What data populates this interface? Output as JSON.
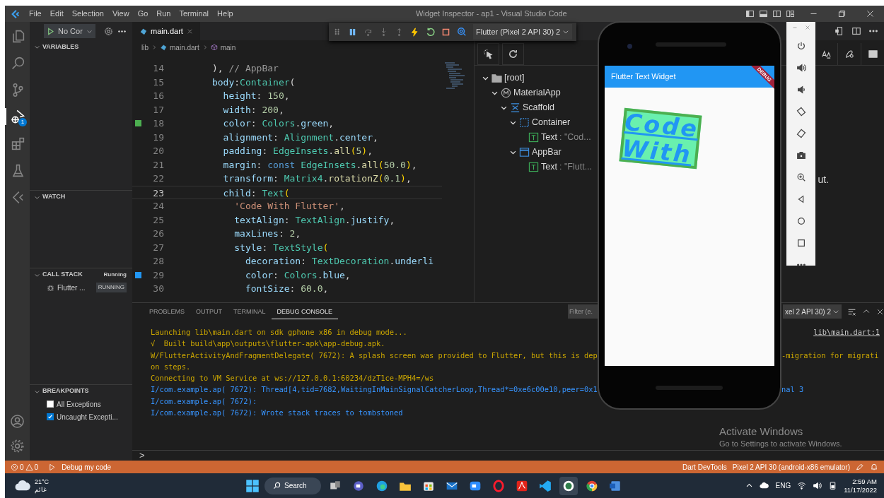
{
  "window": {
    "title": "Widget Inspector - ap1 - Visual Studio Code"
  },
  "menu": [
    "File",
    "Edit",
    "Selection",
    "View",
    "Go",
    "Run",
    "Terminal",
    "Help"
  ],
  "activity_bar": {
    "items": [
      {
        "selected": false
      },
      {
        "selected": false
      },
      {
        "selected": false
      },
      {
        "selected": true,
        "badge": "1"
      },
      {
        "selected": false
      },
      {
        "selected": false
      },
      {
        "selected": false
      }
    ]
  },
  "run_toolbar": {
    "config": "No Cor"
  },
  "sidebar": {
    "sections": [
      {
        "title": "VARIABLES",
        "expanded": true
      },
      {
        "title": "WATCH",
        "expanded": true
      },
      {
        "title": "CALL STACK",
        "expanded": true,
        "status": "Running",
        "items": [
          {
            "label": "Flutter ...",
            "badge": "RUNNING"
          }
        ]
      },
      {
        "title": "BREAKPOINTS",
        "expanded": true,
        "items": [
          {
            "label": "All Exceptions",
            "checked": false
          },
          {
            "label": "Uncaught Excepti...",
            "checked": true
          }
        ]
      }
    ]
  },
  "debug_toolbar": {
    "target": "Flutter (Pixel 2 API 30) 2"
  },
  "editor": {
    "tabs": [
      {
        "label": "main.dart",
        "selected": true
      }
    ],
    "breadcrumb": [
      "lib",
      "main.dart",
      "main"
    ],
    "lines": [
      {
        "number": "14",
        "current": false,
        "tokens": [
          {
            "kind": "punct",
            "text": "      ), "
          },
          {
            "kind": "comment",
            "text": "// AppBar"
          }
        ]
      },
      {
        "number": "15",
        "current": false,
        "tokens": [
          {
            "kind": "prop",
            "text": "      body"
          },
          {
            "kind": "punct",
            "text": ":"
          },
          {
            "kind": "type",
            "text": "Container"
          },
          {
            "kind": "punct",
            "text": "("
          }
        ]
      },
      {
        "number": "16",
        "current": false,
        "tokens": [
          {
            "kind": "prop",
            "text": "        height"
          },
          {
            "kind": "punct",
            "text": ": "
          },
          {
            "kind": "num",
            "text": "150"
          },
          {
            "kind": "punct",
            "text": ","
          }
        ]
      },
      {
        "number": "17",
        "current": false,
        "tokens": [
          {
            "kind": "prop",
            "text": "        width"
          },
          {
            "kind": "punct",
            "text": ": "
          },
          {
            "kind": "num",
            "text": "200"
          },
          {
            "kind": "punct",
            "text": ","
          }
        ]
      },
      {
        "number": "18",
        "current": false,
        "color": "#4caf50",
        "tokens": [
          {
            "kind": "prop",
            "text": "        color"
          },
          {
            "kind": "punct",
            "text": ": "
          },
          {
            "kind": "type",
            "text": "Colors"
          },
          {
            "kind": "punct",
            "text": "."
          },
          {
            "kind": "prop",
            "text": "green"
          },
          {
            "kind": "punct",
            "text": ","
          }
        ]
      },
      {
        "number": "19",
        "current": false,
        "tokens": [
          {
            "kind": "prop",
            "text": "        alignment"
          },
          {
            "kind": "punct",
            "text": ": "
          },
          {
            "kind": "type",
            "text": "Alignment"
          },
          {
            "kind": "punct",
            "text": "."
          },
          {
            "kind": "prop",
            "text": "center"
          },
          {
            "kind": "punct",
            "text": ","
          }
        ]
      },
      {
        "number": "20",
        "current": false,
        "tokens": [
          {
            "kind": "prop",
            "text": "        padding"
          },
          {
            "kind": "punct",
            "text": ": "
          },
          {
            "kind": "type",
            "text": "EdgeInsets"
          },
          {
            "kind": "punct",
            "text": "."
          },
          {
            "kind": "method",
            "text": "all"
          },
          {
            "kind": "paren",
            "text": "("
          },
          {
            "kind": "num",
            "text": "5"
          },
          {
            "kind": "paren",
            "text": ")"
          },
          {
            "kind": "punct",
            "text": ","
          }
        ]
      },
      {
        "number": "21",
        "current": false,
        "tokens": [
          {
            "kind": "prop",
            "text": "        margin"
          },
          {
            "kind": "punct",
            "text": ": "
          },
          {
            "kind": "kw",
            "text": "const "
          },
          {
            "kind": "type",
            "text": "EdgeInsets"
          },
          {
            "kind": "punct",
            "text": "."
          },
          {
            "kind": "method",
            "text": "all"
          },
          {
            "kind": "paren",
            "text": "("
          },
          {
            "kind": "num",
            "text": "50.0"
          },
          {
            "kind": "paren",
            "text": ")"
          },
          {
            "kind": "punct",
            "text": ","
          }
        ]
      },
      {
        "number": "22",
        "current": false,
        "tokens": [
          {
            "kind": "prop",
            "text": "        transform"
          },
          {
            "kind": "punct",
            "text": ": "
          },
          {
            "kind": "type",
            "text": "Matrix4"
          },
          {
            "kind": "punct",
            "text": "."
          },
          {
            "kind": "method",
            "text": "rotationZ"
          },
          {
            "kind": "paren",
            "text": "("
          },
          {
            "kind": "num",
            "text": "0.1"
          },
          {
            "kind": "paren",
            "text": ")"
          },
          {
            "kind": "punct",
            "text": ","
          }
        ]
      },
      {
        "number": "23",
        "current": true,
        "tokens": [
          {
            "kind": "prop",
            "text": "        child"
          },
          {
            "kind": "punct",
            "text": ": "
          },
          {
            "kind": "type",
            "text": "Text"
          },
          {
            "kind": "paren",
            "text": "("
          }
        ]
      },
      {
        "number": "24",
        "current": false,
        "tokens": [
          {
            "kind": "str",
            "text": "          'Code With Flutter'"
          },
          {
            "kind": "punct",
            "text": ","
          }
        ]
      },
      {
        "number": "25",
        "current": false,
        "tokens": [
          {
            "kind": "prop",
            "text": "          textAlign"
          },
          {
            "kind": "punct",
            "text": ": "
          },
          {
            "kind": "type",
            "text": "TextAlign"
          },
          {
            "kind": "punct",
            "text": "."
          },
          {
            "kind": "prop",
            "text": "justify"
          },
          {
            "kind": "punct",
            "text": ","
          }
        ]
      },
      {
        "number": "26",
        "current": false,
        "tokens": [
          {
            "kind": "prop",
            "text": "          maxLines"
          },
          {
            "kind": "punct",
            "text": ": "
          },
          {
            "kind": "num",
            "text": "2"
          },
          {
            "kind": "punct",
            "text": ","
          }
        ]
      },
      {
        "number": "27",
        "current": false,
        "tokens": [
          {
            "kind": "prop",
            "text": "          style"
          },
          {
            "kind": "punct",
            "text": ": "
          },
          {
            "kind": "type",
            "text": "TextStyle"
          },
          {
            "kind": "paren",
            "text": "("
          }
        ]
      },
      {
        "number": "28",
        "current": false,
        "tokens": [
          {
            "kind": "prop",
            "text": "            decoration"
          },
          {
            "kind": "punct",
            "text": ": "
          },
          {
            "kind": "type",
            "text": "TextDecoration"
          },
          {
            "kind": "punct",
            "text": "."
          },
          {
            "kind": "prop",
            "text": "underli"
          }
        ]
      },
      {
        "number": "29",
        "current": false,
        "color": "#2196f3",
        "tokens": [
          {
            "kind": "prop",
            "text": "            color"
          },
          {
            "kind": "punct",
            "text": ": "
          },
          {
            "kind": "type",
            "text": "Colors"
          },
          {
            "kind": "punct",
            "text": "."
          },
          {
            "kind": "prop",
            "text": "blue"
          },
          {
            "kind": "punct",
            "text": ","
          }
        ]
      },
      {
        "number": "30",
        "current": false,
        "tokens": [
          {
            "kind": "prop",
            "text": "            fontSize"
          },
          {
            "kind": "punct",
            "text": ": "
          },
          {
            "kind": "num",
            "text": "60.0"
          },
          {
            "kind": "punct",
            "text": ","
          }
        ]
      }
    ]
  },
  "inspector": {
    "tree": [
      {
        "label": "[root]",
        "kind": "folder",
        "expanded": true,
        "children": [
          {
            "label": "MaterialApp",
            "kind": "material",
            "expanded": true,
            "children": [
              {
                "label": "Scaffold",
                "kind": "scaffold",
                "expanded": true,
                "children": [
                  {
                    "label": "Container",
                    "kind": "container",
                    "expanded": true,
                    "children": [
                      {
                        "label": "Text",
                        "kind": "text",
                        "detail": ": \"Cod..."
                      }
                    ]
                  },
                  {
                    "label": "AppBar",
                    "kind": "appbar",
                    "expanded": true,
                    "children": [
                      {
                        "label": "Text",
                        "kind": "text",
                        "detail": ": \"Flutt..."
                      }
                    ]
                  }
                ]
              }
            ]
          }
        ]
      }
    ],
    "message_fragment": "ut."
  },
  "phone": {
    "app_bar_title": "Flutter Text Widget",
    "banner": "DEBUG",
    "container_text": "Code With"
  },
  "panel": {
    "tabs": [
      {
        "label": "PROBLEMS",
        "selected": false
      },
      {
        "label": "OUTPUT",
        "selected": false
      },
      {
        "label": "TERMINAL",
        "selected": false
      },
      {
        "label": "DEBUG CONSOLE",
        "selected": true
      }
    ],
    "filter": {
      "placeholder": "Filter (e."
    },
    "session": "xel 2 API 30) 2",
    "lines": [
      {
        "kind": "warn",
        "text": "Launching lib\\main.dart on sdk gphone x86 in debug mode...",
        "link": "lib\\main.dart:1"
      },
      {
        "kind": "warn",
        "text": "√  Built build\\app\\outputs\\flutter-apk\\app-debug.apk."
      },
      {
        "kind": "warn",
        "text": "W/FlutterActivityAndFragmentDelegate( 7672): A splash screen was provided to Flutter, but this is dep",
        "tail": "-migration for migrati"
      },
      {
        "kind": "warn",
        "text": "on steps."
      },
      {
        "kind": "warn",
        "text": "Connecting to VM Service at ws://127.0.0.1:60234/dzT1ce-MPH4=/ws"
      },
      {
        "kind": "info",
        "text": "I/com.example.ap( 7672): Thread[4,tid=7682,WaitingInMainSignalCatcherLoop,Thread*=0xe6c00e10,peer=0x1",
        "tail": "nal 3"
      },
      {
        "kind": "info",
        "text": "I/com.example.ap( 7672):"
      },
      {
        "kind": "info",
        "text": "I/com.example.ap( 7672): Wrote stack traces to tombstoned"
      }
    ],
    "prompt": ">"
  },
  "activation": {
    "title": "Activate Windows",
    "subtitle": "Go to Settings to activate Windows."
  },
  "status_bar": {
    "errors": "0",
    "warnings": "0",
    "launch": "Debug my code",
    "devtools": "Dart DevTools",
    "device": "Pixel 2 API 30 (android-x86 emulator)"
  },
  "taskbar": {
    "weather": {
      "temp": "21°C",
      "condition": "غائم"
    },
    "search": "Search",
    "apps": [
      {
        "selected": false
      },
      {
        "selected": false
      },
      {
        "selected": false
      },
      {
        "selected": false
      },
      {
        "selected": false
      },
      {
        "selected": false
      },
      {
        "selected": false
      },
      {
        "selected": false
      },
      {
        "selected": false
      },
      {
        "selected": false
      },
      {
        "selected": true
      },
      {
        "selected": false
      },
      {
        "selected": false
      }
    ],
    "language": "ENG",
    "time": "2:59 AM",
    "date": "11/17/2022"
  }
}
